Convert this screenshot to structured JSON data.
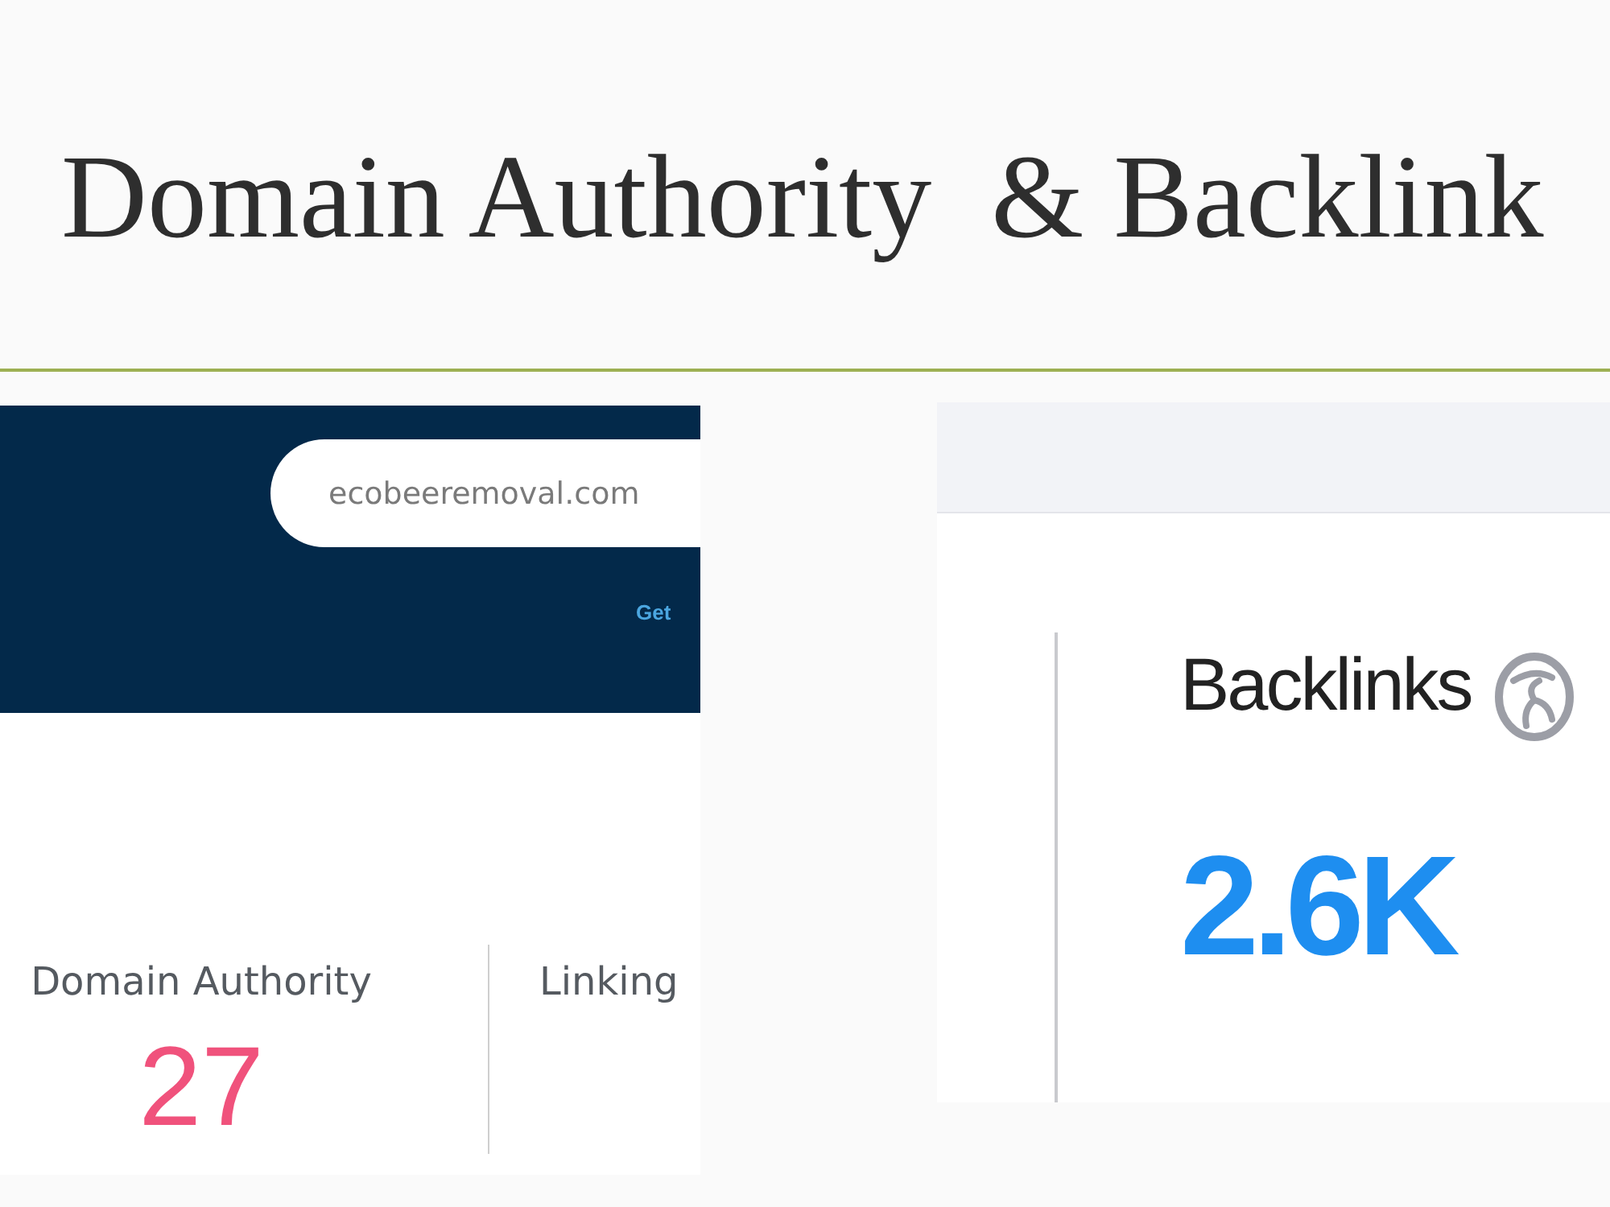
{
  "slide": {
    "title": "Domain Authority  & Backlink"
  },
  "left_screenshot": {
    "search_field": {
      "value": "ecobeeremoval.com"
    },
    "link_text": "Get",
    "stats": [
      {
        "label": "Domain Authority",
        "value": "27"
      },
      {
        "label": "Linking"
      }
    ]
  },
  "right_screenshot": {
    "metric": {
      "label": "Backlinks",
      "value": "2.6K"
    }
  }
}
